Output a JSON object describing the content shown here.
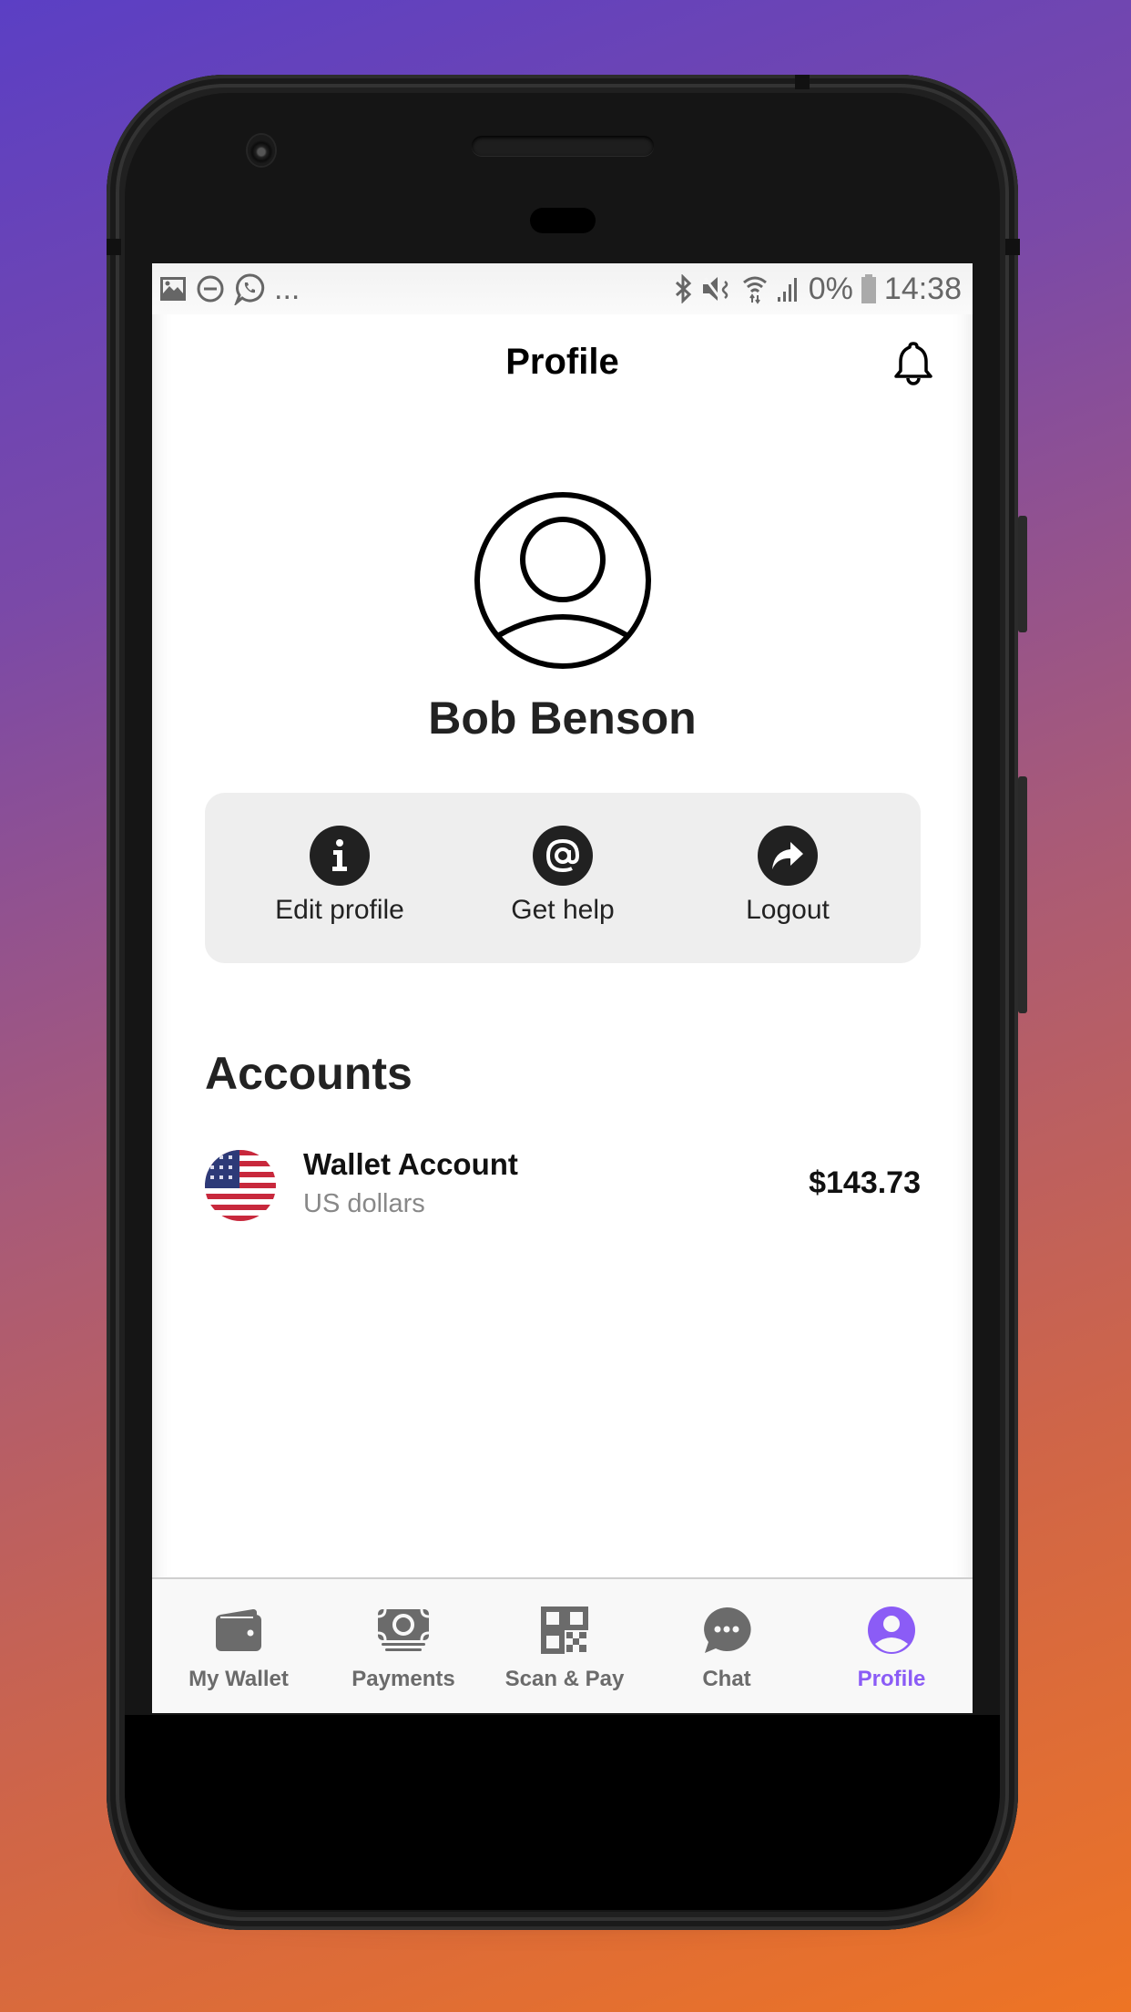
{
  "status_bar": {
    "left_icons": [
      "gallery-icon",
      "do-not-disturb-icon",
      "whatsapp-icon"
    ],
    "overflow": "...",
    "right_icons": [
      "bluetooth-icon",
      "mute-icon",
      "wifi-icon",
      "signal-icon"
    ],
    "battery_percent": "0%",
    "time": "14:38"
  },
  "header": {
    "title": "Profile",
    "notification_icon": "bell-icon"
  },
  "profile": {
    "avatar_icon": "user-circle-icon",
    "name": "Bob Benson"
  },
  "actions": [
    {
      "label": "Edit profile",
      "icon": "info-icon"
    },
    {
      "label": "Get help",
      "icon": "at-icon"
    },
    {
      "label": "Logout",
      "icon": "share-arrow-icon"
    }
  ],
  "accounts": {
    "title": "Accounts",
    "items": [
      {
        "name": "Wallet Account",
        "currency": "US dollars",
        "balance": "$143.73",
        "flag": "us-flag-icon"
      }
    ]
  },
  "bottom_nav": {
    "active_color": "#8b5cf6",
    "inactive_color": "#6b6b6b",
    "items": [
      {
        "label": "My Wallet",
        "icon": "wallet-icon",
        "active": false
      },
      {
        "label": "Payments",
        "icon": "money-icon",
        "active": false
      },
      {
        "label": "Scan & Pay",
        "icon": "qr-code-icon",
        "active": false
      },
      {
        "label": "Chat",
        "icon": "chat-bubble-icon",
        "active": false
      },
      {
        "label": "Profile",
        "icon": "profile-icon",
        "active": true
      }
    ]
  }
}
